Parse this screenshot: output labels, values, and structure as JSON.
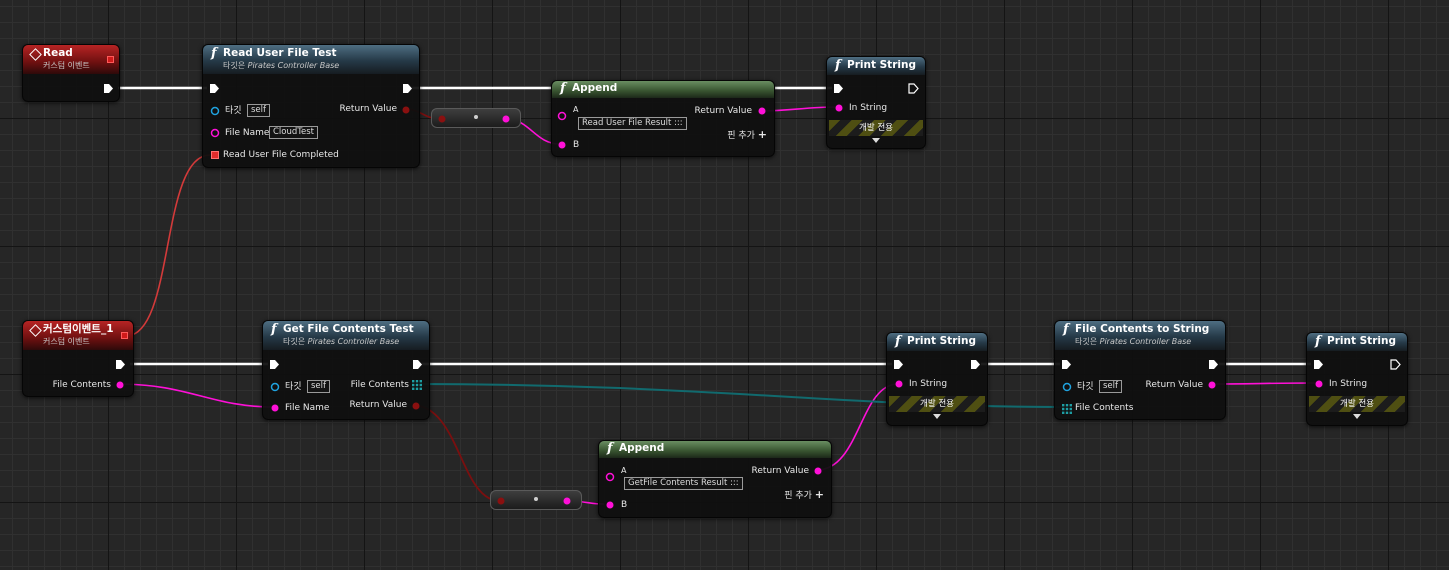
{
  "nodes": {
    "read_event": {
      "title": "Read",
      "subtitle": "커스텀 이벤트"
    },
    "read_file": {
      "title": "Read User File Test",
      "subtitle_prefix": "타깃은 ",
      "subtitle_target": "Pirates Controller Base",
      "target_label": "타깃",
      "target_value": "self",
      "filename_label": "File Name",
      "filename_value": "CloudTest",
      "completed_label": "Read User File Completed",
      "return_label": "Return Value"
    },
    "append_1": {
      "title": "Append",
      "a_label": "A",
      "a_value": "Read User File Result :::",
      "b_label": "B",
      "return_label": "Return Value",
      "add_pin": "핀 추가"
    },
    "print_1": {
      "title": "Print String",
      "in_label": "In String",
      "dev_only": "개발 전용"
    },
    "custom_event_1": {
      "title": "커스텀이벤트_1",
      "subtitle": "커스텀 이벤트",
      "out_label": "File Contents"
    },
    "get_file": {
      "title": "Get File Contents Test",
      "subtitle_prefix": "타깃은 ",
      "subtitle_target": "Pirates Controller Base",
      "target_label": "타깃",
      "target_value": "self",
      "filename_label": "File Name",
      "contents_label": "File Contents",
      "return_label": "Return Value"
    },
    "print_2": {
      "title": "Print String",
      "in_label": "In String",
      "dev_only": "개발 전용"
    },
    "contents_to_string": {
      "title": "File Contents to String",
      "subtitle_prefix": "타깃은 ",
      "subtitle_target": "Pirates Controller Base",
      "target_label": "타깃",
      "target_value": "self",
      "contents_label": "File Contents",
      "return_label": "Return Value"
    },
    "print_3": {
      "title": "Print String",
      "in_label": "In String",
      "dev_only": "개발 전용"
    },
    "append_2": {
      "title": "Append",
      "a_label": "A",
      "a_value": "GetFile Contents Result :::",
      "b_label": "B",
      "return_label": "Return Value",
      "add_pin": "핀 추가"
    }
  },
  "colors": {
    "exec": "#ffffff",
    "string_pin": "#ff10d8",
    "array_wire": "#116a6e",
    "struct_wire": "#7a0f0f",
    "object_pin": "#1fa3e0",
    "event_wire": "#d33a3a"
  }
}
